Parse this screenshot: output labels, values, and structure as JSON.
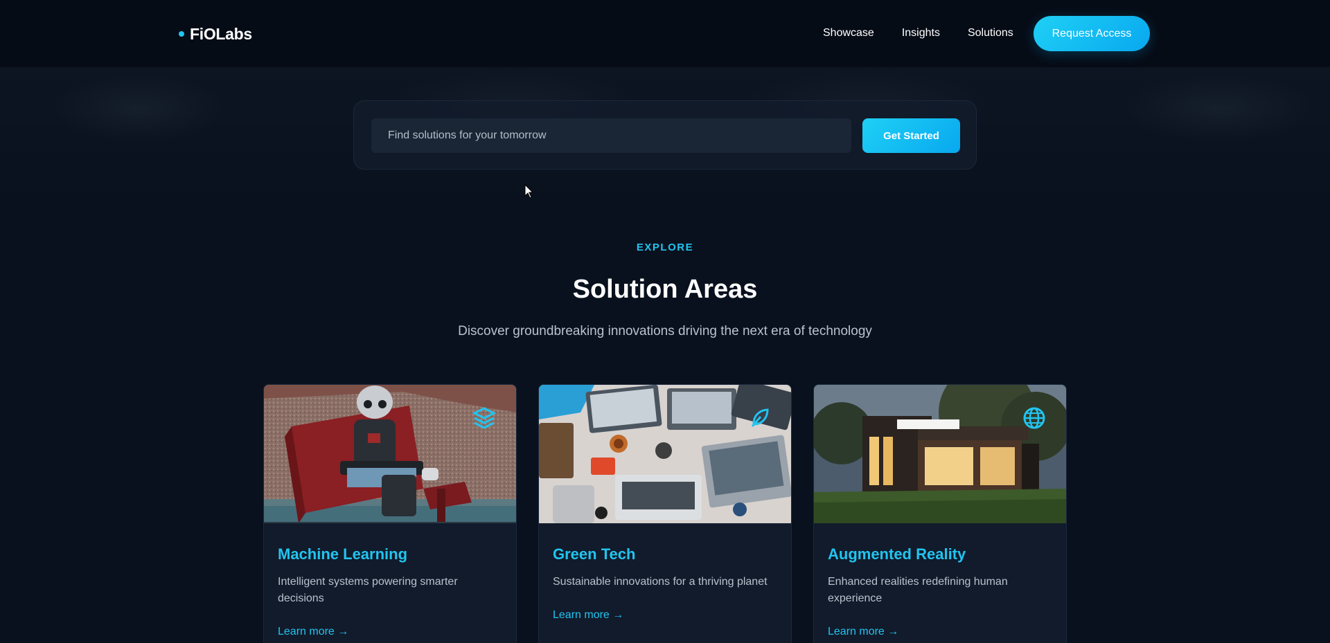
{
  "brand": {
    "name": "FiOLabs",
    "accent": "#22c4f0"
  },
  "nav": {
    "links": [
      "Showcase",
      "Insights",
      "Solutions"
    ],
    "cta_label": "Request Access"
  },
  "search": {
    "placeholder": "Find solutions for your tomorrow",
    "button_label": "Get Started"
  },
  "section": {
    "eyebrow": "EXPLORE",
    "title": "Solution Areas",
    "subtitle": "Discover groundbreaking innovations driving the next era of technology"
  },
  "cards": [
    {
      "title": "Machine Learning",
      "description": "Intelligent systems powering smarter decisions",
      "link_label": "Learn more →",
      "icon": "layers-icon",
      "image": "robot-reading-on-bench"
    },
    {
      "title": "Green Tech",
      "description": "Sustainable innovations for a thriving planet",
      "link_label": "Learn more →",
      "icon": "leaf-icon",
      "image": "laptops-on-table-overhead"
    },
    {
      "title": "Augmented Reality",
      "description": "Enhanced realities redefining human experience",
      "link_label": "Learn more →",
      "icon": "globe-icon",
      "image": "modern-house-at-dusk"
    }
  ]
}
